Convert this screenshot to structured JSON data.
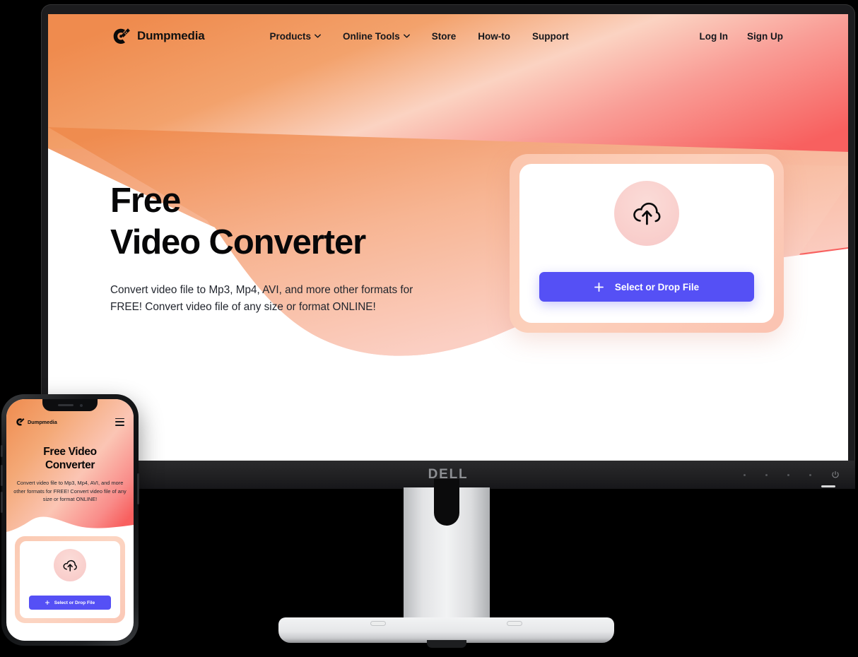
{
  "brand": {
    "name": "Dumpmedia",
    "logo_icon": "dumpmedia-logo-icon"
  },
  "nav": {
    "items": [
      {
        "label": "Products",
        "has_dropdown": true
      },
      {
        "label": "Online Tools",
        "has_dropdown": true
      },
      {
        "label": "Store",
        "has_dropdown": false
      },
      {
        "label": "How-to",
        "has_dropdown": false
      },
      {
        "label": "Support",
        "has_dropdown": false
      }
    ],
    "auth": [
      {
        "label": "Log In"
      },
      {
        "label": "Sign Up"
      }
    ]
  },
  "hero": {
    "title_line1": "Free",
    "title_line2": "Video Converter",
    "subtitle": "Convert video file to Mp3, Mp4, AVI, and more other formats for FREE! Convert video file of any size or format ONLINE!"
  },
  "upload": {
    "icon": "cloud-upload-icon",
    "button_label": "Select or Drop File",
    "button_icon": "plus-icon",
    "button_color": "#5550f5",
    "frame_color": "#fbc6ae"
  },
  "phone": {
    "brand_name": "Dumpmedia",
    "menu_icon": "hamburger-menu-icon",
    "title_line1": "Free Video",
    "title_line2": "Converter",
    "subtitle": "Convert video file to Mp3, Mp4, AVI, and more other formats for FREE! Convert video file of any size or format ONLINE!",
    "button_label": "Select or Drop File"
  },
  "monitor": {
    "brand": "DELL",
    "power_icon": "power-icon"
  },
  "colors": {
    "gradient_orange": "#ef8b4e",
    "gradient_peach": "#fad2c2",
    "gradient_coral": "#f9706e",
    "accent_indigo": "#5550f5",
    "text_dark": "#070708"
  }
}
